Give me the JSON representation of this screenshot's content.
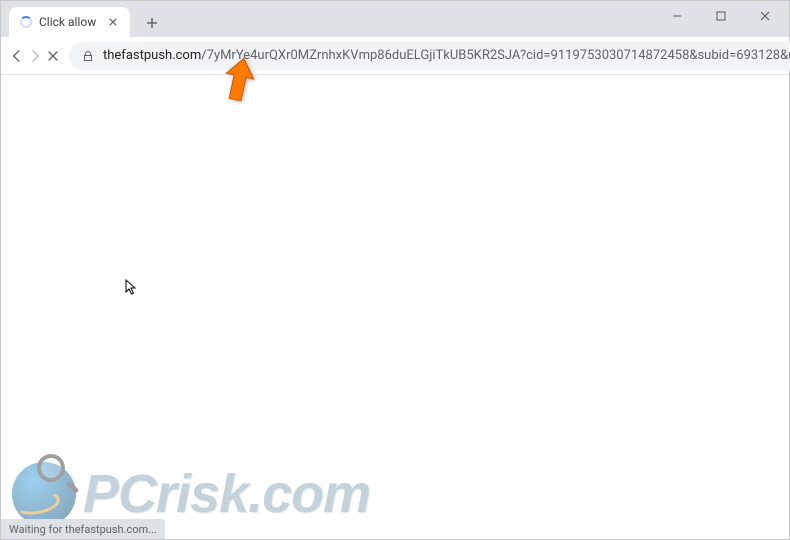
{
  "tab": {
    "title": "Click allow",
    "loading": true
  },
  "address": {
    "domain": "thefastpush.com",
    "path": "/7yMrYe4urQXr0MZrnhxKVmp86duELGjiTkUB5KR2SJA?cid=9119753030714872458&subid=693128&utm_..."
  },
  "status": {
    "text": "Waiting for thefastpush.com..."
  },
  "watermark": {
    "text": "PCrisk.com"
  }
}
